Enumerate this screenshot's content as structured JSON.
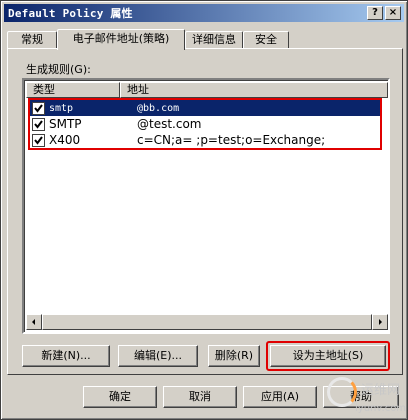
{
  "window": {
    "title": "Default Policy 属性",
    "help_btn": "?",
    "close_btn": "×"
  },
  "tabs": [
    {
      "label": "常规"
    },
    {
      "label": "电子邮件地址(策略)"
    },
    {
      "label": "详细信息"
    },
    {
      "label": "安全"
    }
  ],
  "panel": {
    "rules_label": "生成规则(G):",
    "columns": {
      "type": "类型",
      "address": "地址"
    },
    "rows": [
      {
        "type": "smtp",
        "address": "@bb.com",
        "checked": true
      },
      {
        "type": "SMTP",
        "address": "@test.com",
        "checked": true
      },
      {
        "type": "X400",
        "address": "c=CN;a= ;p=test;o=Exchange;",
        "checked": true
      }
    ],
    "buttons": {
      "new": "新建(N)...",
      "edit": "编辑(E)...",
      "remove": "删除(R)",
      "set_primary": "设为主地址(S)"
    }
  },
  "footer": {
    "ok": "确定",
    "cancel": "取消",
    "apply": "应用(A)",
    "help": "帮助"
  },
  "watermark": {
    "line1": "运维网",
    "line2": "iyunv.com"
  },
  "colors": {
    "selection": "#0a246a",
    "highlight_outline": "#e00000",
    "face": "#d4d0c8"
  }
}
